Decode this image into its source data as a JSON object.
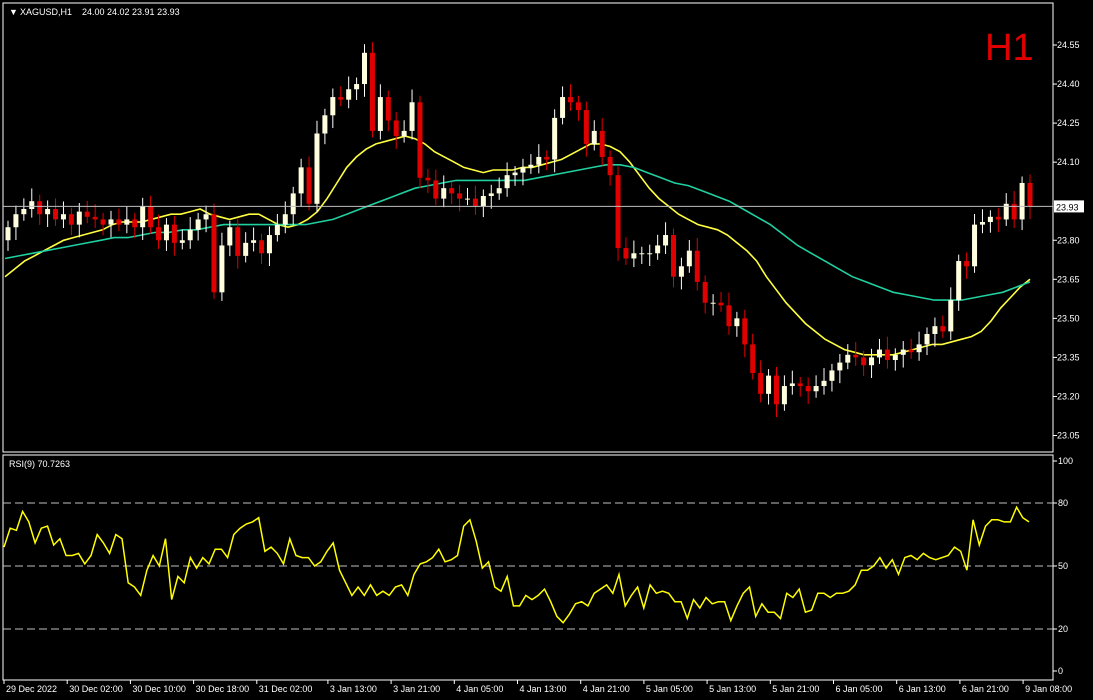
{
  "chart_data": [
    {
      "type": "candlestick",
      "header": {
        "symbol": "XAGUSD,H1",
        "ohlc": "24.00 24.02 23.91 23.93"
      },
      "timeframe_badge": "H1",
      "price_ticks": [
        "24.55",
        "24.40",
        "24.25",
        "24.10",
        "23.80",
        "23.65",
        "23.50",
        "23.35",
        "23.20",
        "23.05"
      ],
      "price_tick_values": [
        24.55,
        24.4,
        24.25,
        24.1,
        23.8,
        23.65,
        23.5,
        23.35,
        23.2,
        23.05
      ],
      "ylim": [
        22.99,
        24.76
      ],
      "current_price": {
        "value": 23.93,
        "label": "23.93",
        "color": "#c0c0c0"
      },
      "time_labels": [
        "29 Dec 2022",
        "30 Dec 02:00",
        "30 Dec 10:00",
        "30 Dec 18:00",
        "31 Dec 02:00",
        "3 Jan 13:00",
        "3 Jan 21:00",
        "4 Jan 05:00",
        "4 Jan 13:00",
        "4 Jan 21:00",
        "5 Jan 05:00",
        "5 Jan 13:00",
        "5 Jan 21:00",
        "6 Jan 05:00",
        "6 Jan 13:00",
        "6 Jan 21:00",
        "9 Jan 08:00"
      ],
      "time_label_bars": [
        0,
        8,
        16,
        24,
        32,
        41,
        49,
        57,
        65,
        73,
        81,
        89,
        97,
        105,
        113,
        121,
        129
      ],
      "bull_color": "#ffffe0",
      "bear_color": "#e00000",
      "series": [
        {
          "name": "MA fast",
          "color": "#ffff40",
          "values": [
            23.66,
            23.69,
            23.72,
            23.74,
            23.76,
            23.78,
            23.8,
            23.81,
            23.82,
            23.83,
            23.84,
            23.86,
            23.87,
            23.87,
            23.87,
            23.88,
            23.89,
            23.9,
            23.9,
            23.91,
            23.92,
            23.9,
            23.89,
            23.88,
            23.89,
            23.9,
            23.9,
            23.88,
            23.86,
            23.85,
            23.86,
            23.88,
            23.91,
            23.96,
            24.02,
            24.08,
            24.12,
            24.15,
            24.17,
            24.18,
            24.19,
            24.2,
            24.19,
            24.17,
            24.14,
            24.12,
            24.1,
            24.08,
            24.07,
            24.06,
            24.07,
            24.07,
            24.07,
            24.08,
            24.08,
            24.09,
            24.1,
            24.11,
            24.13,
            24.15,
            24.17,
            24.17,
            24.16,
            24.14,
            24.1,
            24.05,
            24.0,
            23.96,
            23.93,
            23.9,
            23.88,
            23.86,
            23.85,
            23.84,
            23.82,
            23.79,
            23.76,
            23.72,
            23.66,
            23.61,
            23.56,
            23.52,
            23.48,
            23.45,
            23.42,
            23.4,
            23.38,
            23.37,
            23.36,
            23.36,
            23.36,
            23.36,
            23.37,
            23.38,
            23.39,
            23.4,
            23.4,
            23.41,
            23.42,
            23.43,
            23.45,
            23.49,
            23.54,
            23.58,
            23.62,
            23.65
          ]
        },
        {
          "name": "MA slow",
          "color": "#20d0a0",
          "values": [
            23.73,
            23.74,
            23.75,
            23.76,
            23.77,
            23.78,
            23.79,
            23.8,
            23.81,
            23.81,
            23.82,
            23.83,
            23.83,
            23.84,
            23.84,
            23.85,
            23.86,
            23.86,
            23.86,
            23.86,
            23.86,
            23.86,
            23.86,
            23.87,
            23.88,
            23.9,
            23.92,
            23.94,
            23.96,
            23.98,
            24.0,
            24.01,
            24.02,
            24.03,
            24.03,
            24.03,
            24.03,
            24.03,
            24.03,
            24.04,
            24.05,
            24.06,
            24.07,
            24.08,
            24.09,
            24.09,
            24.08,
            24.06,
            24.04,
            24.02,
            24.01,
            23.99,
            23.97,
            23.95,
            23.92,
            23.89,
            23.86,
            23.82,
            23.78,
            23.75,
            23.72,
            23.69,
            23.66,
            23.64,
            23.62,
            23.6,
            23.59,
            23.58,
            23.57,
            23.57,
            23.57,
            23.58,
            23.59,
            23.6,
            23.62,
            23.64
          ]
        },
        {
          "name": "Close",
          "values": [
            23.85,
            23.9,
            23.92,
            23.95,
            23.9,
            23.92,
            23.88,
            23.9,
            23.86,
            23.91,
            23.89,
            23.88,
            23.86,
            23.88,
            23.86,
            23.88,
            23.85,
            23.93,
            23.85,
            23.8,
            23.86,
            23.79,
            23.8,
            23.84,
            23.88,
            23.9,
            23.6,
            23.78,
            23.85,
            23.74,
            23.79,
            23.8,
            23.75,
            23.82,
            23.86,
            23.9,
            23.98,
            24.08,
            23.94,
            24.21,
            24.28,
            24.35,
            24.34,
            24.38,
            24.4,
            24.52,
            24.22,
            24.35,
            24.26,
            24.2,
            24.22,
            24.33,
            24.04,
            24.03,
            23.96,
            24.0,
            23.98,
            23.96,
            23.96,
            23.93,
            23.97,
            23.98,
            24.0,
            24.05,
            24.06,
            24.08,
            24.09,
            24.12,
            24.11,
            24.27,
            24.35,
            24.33,
            24.3,
            24.17,
            24.22,
            24.12,
            24.05,
            23.77,
            23.73,
            23.75,
            23.75,
            23.75,
            23.78,
            23.82,
            23.66,
            23.7,
            23.76,
            23.64,
            23.56,
            23.56,
            23.55,
            23.47,
            23.5,
            23.4,
            23.29,
            23.21,
            23.28,
            23.17,
            23.24,
            23.25,
            23.24,
            23.22,
            23.24,
            23.26,
            23.3,
            23.33,
            23.36,
            23.35,
            23.32,
            23.35,
            23.38,
            23.34,
            23.36,
            23.38,
            23.37,
            23.4,
            23.44,
            23.47,
            23.45,
            23.57,
            23.72,
            23.7,
            23.86,
            23.87,
            23.89,
            23.88,
            23.94,
            23.88,
            24.02,
            23.93
          ]
        }
      ]
    },
    {
      "type": "line",
      "label": "RSI(9) 70.7263",
      "ticks": [
        "100",
        "80",
        "50",
        "20",
        "0"
      ],
      "tick_values": [
        100,
        80,
        50,
        20,
        0
      ],
      "ylim": [
        0,
        100
      ],
      "series": [
        {
          "name": "RSI(9)",
          "color": "#ffff00",
          "values": [
            59,
            68,
            67,
            76,
            71,
            61,
            68,
            69,
            60,
            63,
            55,
            55,
            56,
            51,
            55,
            65,
            61,
            56,
            65,
            63,
            42,
            40,
            36,
            48,
            55,
            50,
            63,
            34,
            45,
            42,
            54,
            49,
            54,
            51,
            58,
            58,
            54,
            65,
            68,
            70,
            71,
            73,
            57,
            59,
            56,
            51,
            63,
            55,
            54,
            54,
            50,
            52,
            57,
            61,
            48,
            42,
            36,
            40,
            36,
            41,
            36,
            38,
            36,
            40,
            41,
            36,
            46,
            51,
            52,
            54,
            58,
            52,
            53,
            55,
            69,
            72,
            62,
            49,
            52,
            40,
            38,
            45,
            31,
            31,
            36,
            34,
            36,
            39,
            33,
            26,
            23,
            27,
            32,
            33,
            31,
            37,
            39,
            41,
            37,
            46,
            31,
            36,
            40,
            30,
            41,
            37,
            38,
            37,
            33,
            33,
            25,
            34,
            30,
            35,
            32,
            33,
            33,
            24,
            31,
            37,
            40,
            26,
            32,
            28,
            28,
            25,
            37,
            35,
            39,
            28,
            29,
            37,
            37,
            35,
            37,
            37,
            38,
            41,
            48,
            48,
            50,
            54,
            49,
            53,
            46,
            54,
            55,
            53,
            56,
            54,
            53,
            54,
            55,
            59,
            57,
            48,
            72,
            60,
            69,
            72,
            72,
            71,
            71,
            78,
            73,
            71
          ]
        }
      ]
    }
  ]
}
